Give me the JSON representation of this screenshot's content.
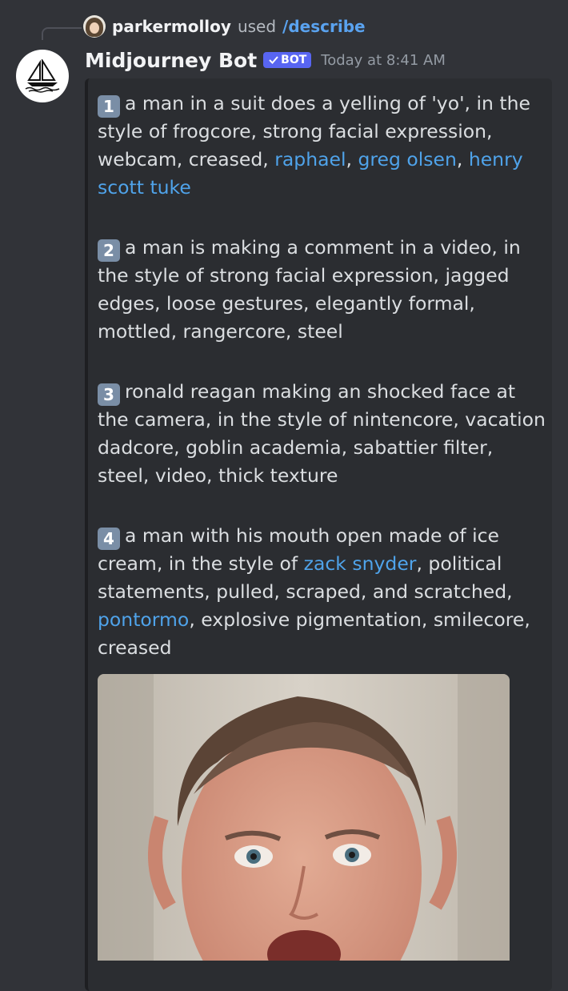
{
  "reply": {
    "username": "parkermolloy",
    "used_text": "used",
    "command": "/describe"
  },
  "message": {
    "author": "Midjourney Bot",
    "badge": "BOT",
    "timestamp": "Today at 8:41 AM"
  },
  "descriptions": [
    {
      "number": "1",
      "segments": [
        {
          "text": "a man in a suit does a yelling of 'yo', in the style of frogcore, strong facial expression, webcam, creased, "
        },
        {
          "text": "raphael",
          "link": true
        },
        {
          "text": ", "
        },
        {
          "text": "greg olsen",
          "link": true
        },
        {
          "text": ", "
        },
        {
          "text": "henry scott tuke",
          "link": true
        }
      ]
    },
    {
      "number": "2",
      "segments": [
        {
          "text": "a man is making a comment in a video, in the style of strong facial expression, jagged edges, loose gestures, elegantly formal, mottled, rangercore, steel"
        }
      ]
    },
    {
      "number": "3",
      "segments": [
        {
          "text": "ronald reagan making an shocked face at the camera, in the style of nintencore, vacation dadcore, goblin academia, sabattier filter, steel, video, thick texture"
        }
      ]
    },
    {
      "number": "4",
      "segments": [
        {
          "text": "a man with his mouth open made of ice cream, in the style of "
        },
        {
          "text": "zack snyder",
          "link": true
        },
        {
          "text": ", political statements, pulled, scraped, and scratched, "
        },
        {
          "text": "pontormo",
          "link": true
        },
        {
          "text": ", explosive pigmentation, smilecore, creased"
        }
      ]
    }
  ],
  "colors": {
    "background": "#313338",
    "embed": "#2b2d31",
    "link": "#4fa3ea",
    "badge": "#5865f2",
    "command": "#5aa3f0"
  },
  "icons": {
    "bot_avatar": "sailboat-icon",
    "badge_check": "checkmark-icon"
  }
}
